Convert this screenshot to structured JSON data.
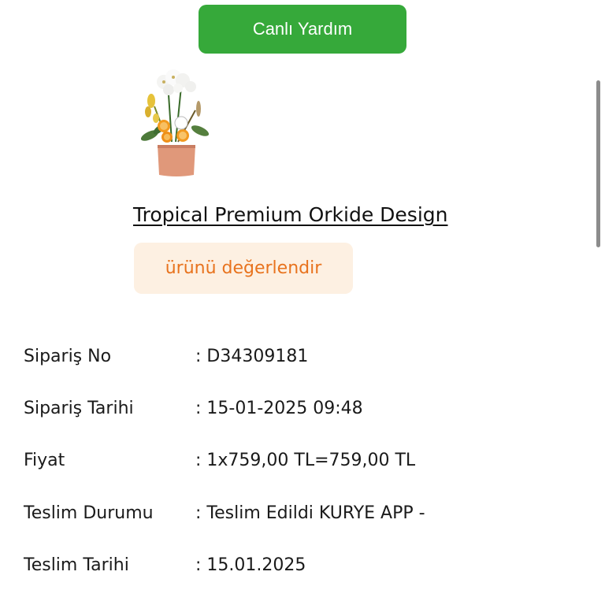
{
  "header": {
    "live_help_label": "Canlı Yardım"
  },
  "product": {
    "image_icon": "orchid-arrangement-image",
    "title": "Tropical Premium Orkide Design",
    "rate_label": "ürünü değerlendir"
  },
  "order_details": [
    {
      "label": "Sipariş No",
      "value": ": D34309181"
    },
    {
      "label": "Sipariş Tarihi",
      "value": ": 15-01-2025 09:48"
    },
    {
      "label": "Fiyat",
      "value": ": 1x759,00 TL=759,00 TL"
    },
    {
      "label": "Teslim Durumu",
      "value": ": Teslim Edildi KURYE APP -"
    },
    {
      "label": "Teslim Tarihi",
      "value": ": 15.01.2025"
    }
  ],
  "colors": {
    "live_help_bg": "#36a93a",
    "rate_bg": "#fdf0e2",
    "rate_text": "#e8731e"
  }
}
